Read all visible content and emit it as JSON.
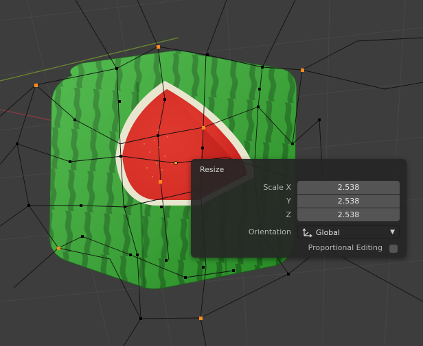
{
  "operator_panel": {
    "title": "Resize",
    "scale_x_label": "Scale X",
    "scale_x_value": "2.538",
    "scale_y_label": "Y",
    "scale_y_value": "2.538",
    "scale_z_label": "Z",
    "scale_z_value": "2.538",
    "orientation_label": "Orientation",
    "orientation_value": "Global",
    "orientation_icon": "orientation-gizmo-icon",
    "proportional_editing_label": "Proportional Editing",
    "proportional_editing_checked": false
  },
  "viewport": {
    "background_color": "#3d3d3d",
    "grid_line_color": "#4a4a4a",
    "x_axis_color": "#8a3b44",
    "y_axis_color": "#6b8a2e",
    "selected_vertex_color": "#ff8a1a",
    "object": "watermelon-cube"
  }
}
